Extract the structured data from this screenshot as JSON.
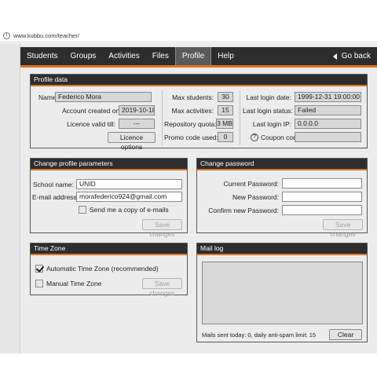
{
  "browser": {
    "url": "www.kubbu.com/teacher/"
  },
  "nav": {
    "tabs": [
      "Students",
      "Groups",
      "Activities",
      "Files",
      "Profile",
      "Help"
    ],
    "active": "Profile",
    "back_label": "Go back"
  },
  "profile": {
    "title": "Profile data",
    "name_label": "Name:",
    "name_value": "Federico Mora",
    "created_label": "Account created on:",
    "created_value": "2019-10-18",
    "licence_label": "Licence valid till:",
    "licence_value": "---",
    "licence_button": "Licence options",
    "max_students_label": "Max students:",
    "max_students_value": "30",
    "max_activities_label": "Max activities:",
    "max_activities_value": "15",
    "repo_label": "Repository quota:",
    "repo_value": "3 MB",
    "promo_label": "Promo code used:",
    "promo_value": "0",
    "last_date_label": "Last login date:",
    "last_date_value": "1999-12-31 19:00:00",
    "last_status_label": "Last login status:",
    "last_status_value": "Failed",
    "last_ip_label": "Last login IP:",
    "last_ip_value": "0.0.0.0",
    "coupon_label": "Coupon code:",
    "coupon_value": ""
  },
  "change_profile": {
    "title": "Change profile parameters",
    "school_label": "School name:",
    "school_value": "UNID",
    "email_label": "E-mail address:",
    "email_value": "morafederico924@gmail.com",
    "copy_label": "Send me a copy of e-mails",
    "copy_checked": false,
    "save_label": "Save changes"
  },
  "change_password": {
    "title": "Change password",
    "current_label": "Current Password:",
    "new_label": "New Password:",
    "confirm_label": "Confirm new Password:",
    "save_label": "Save changes"
  },
  "timezone": {
    "title": "Time Zone",
    "auto_label": "Automatic Time Zone (recommended)",
    "auto_checked": true,
    "manual_label": "Manual Time Zone",
    "manual_checked": false,
    "save_label": "Save changes"
  },
  "mail_log": {
    "title": "Mail log",
    "status": "Mails sent today: 0, daily anti-spam limit: 15",
    "clear_label": "Clear"
  },
  "colors": {
    "nav_bg": "#2d2d2d",
    "accent": "#e0751e",
    "panel_bg": "#ececec"
  }
}
